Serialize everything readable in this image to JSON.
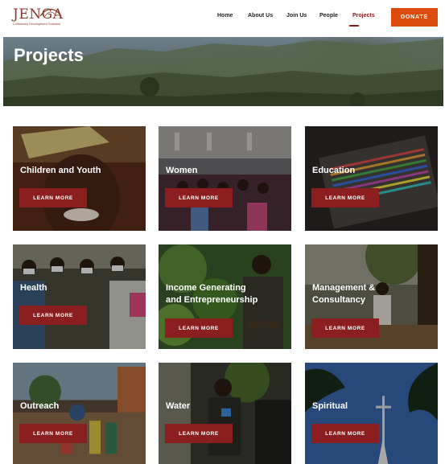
{
  "header": {
    "logo_text": "JENGA",
    "logo_subtitle": "Community Development Outreach",
    "nav": [
      "Home",
      "About Us",
      "Join Us",
      "People",
      "Projects"
    ],
    "active_nav": "Projects",
    "donate_label": "DONATE"
  },
  "hero": {
    "title": "Projects"
  },
  "cards": [
    {
      "title": "Children and Youth",
      "button": "LEARN MORE",
      "image": "smiling-child-photo"
    },
    {
      "title": "Women",
      "button": "LEARN MORE",
      "image": "church-congregation-photo"
    },
    {
      "title": "Education",
      "button": "LEARN MORE",
      "image": "colored-pencils-photo"
    },
    {
      "title": "Health",
      "button": "LEARN MORE",
      "image": "masked-group-photo"
    },
    {
      "title": "Income Generating and Entrepreneurship",
      "title_line1": "Income Generating",
      "title_line2": "and Entrepreneurship",
      "button": "LEARN MORE",
      "image": "farmer-plants-photo"
    },
    {
      "title": "Management & Consultancy",
      "title_line1": "Management &",
      "title_line2": "Consultancy",
      "button": "LEARN MORE",
      "image": "outdoor-meeting-photo"
    },
    {
      "title": "Outreach",
      "button": "LEARN MORE",
      "image": "village-gathering-photo"
    },
    {
      "title": "Water",
      "button": "LEARN MORE",
      "image": "water-pump-photo"
    },
    {
      "title": "Spiritual",
      "button": "LEARN MORE",
      "image": "church-cross-photo"
    }
  ],
  "colors": {
    "accent_button": "#8b1e1e",
    "donate_button": "#dc4d0c",
    "logo": "#8a3a2a"
  }
}
